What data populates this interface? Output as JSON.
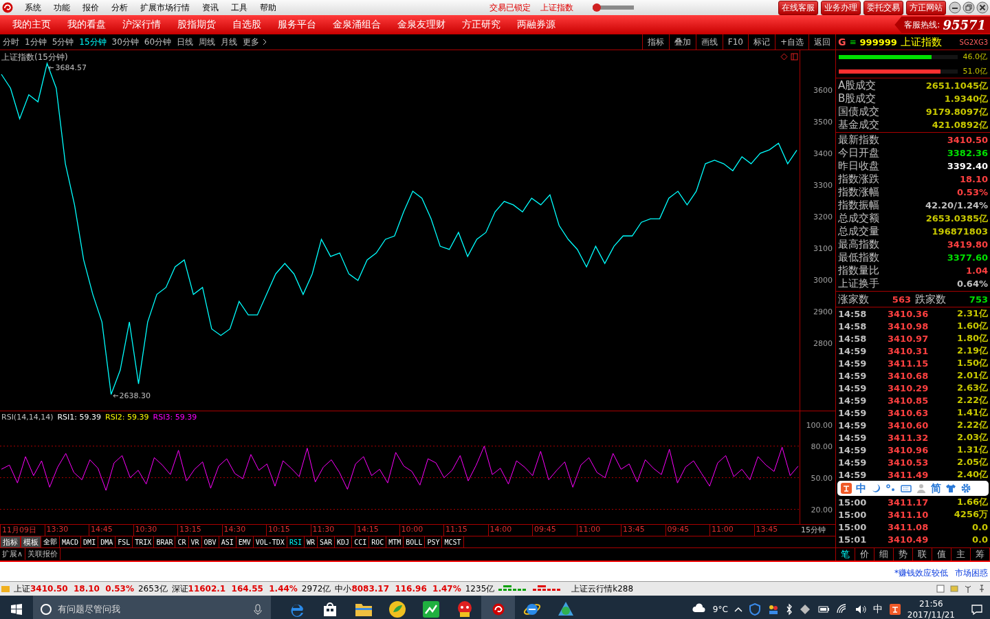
{
  "title_bar": {
    "menus": [
      "系统",
      "功能",
      "报价",
      "分析",
      "扩展市场行情",
      "资讯",
      "工具",
      "帮助"
    ],
    "lock_status": "交易已锁定",
    "security": "上证指数",
    "slider": {
      "level": 0.1
    },
    "buttons": [
      "在线客服",
      "业务办理",
      "委托交易",
      "方正网站"
    ]
  },
  "nav": {
    "items": [
      "我的主页",
      "我的看盘",
      "沪深行情",
      "股指期货",
      "自选股",
      "服务平台",
      "金泉涌组合",
      "金泉友理财",
      "方正研究",
      "两融券源"
    ],
    "hotline_label": "客服热线:",
    "hotline": "95571"
  },
  "periods": [
    {
      "label": "分时",
      "selected": false
    },
    {
      "label": "1分钟",
      "selected": false
    },
    {
      "label": "5分钟",
      "selected": false
    },
    {
      "label": "15分钟",
      "selected": true
    },
    {
      "label": "30分钟",
      "selected": false
    },
    {
      "label": "60分钟",
      "selected": false
    },
    {
      "label": "日线",
      "selected": false
    },
    {
      "label": "周线",
      "selected": false
    },
    {
      "label": "月线",
      "selected": false
    },
    {
      "label": "更多",
      "selected": false
    }
  ],
  "chart_tools": [
    "指标",
    "叠加",
    "画线",
    "F10",
    "标记",
    "+自选",
    "返回"
  ],
  "main_chart": {
    "chart_data": {
      "type": "line",
      "title": "上证指数(15分钟)",
      "ylim": [
        2591,
        3726
      ],
      "yticks": [
        2800,
        2900,
        3000,
        3100,
        3200,
        3300,
        3400,
        3500,
        3600
      ],
      "series": [
        {
          "color": "#00ffff",
          "values": [
            3650,
            3606,
            3509,
            3585,
            3563,
            3684,
            3606,
            3367,
            3237,
            3063,
            2954,
            2867,
            2638,
            2715,
            2867,
            2671,
            2867,
            2954,
            2976,
            3041,
            3063,
            2954,
            2976,
            2845,
            2824,
            2845,
            2932,
            2889,
            2889,
            2954,
            3019,
            3052,
            3019,
            2954,
            3019,
            3128,
            3074,
            3085,
            3019,
            2998,
            3063,
            3085,
            3128,
            3139,
            3215,
            3280,
            3258,
            3193,
            3106,
            3096,
            3150,
            3074,
            3128,
            3150,
            3215,
            3248,
            3237,
            3215,
            3258,
            3237,
            3269,
            3172,
            3128,
            3096,
            3041,
            3106,
            3052,
            3106,
            3139,
            3139,
            3182,
            3193,
            3193,
            3258,
            3280,
            3237,
            3280,
            3367,
            3378,
            3367,
            3345,
            3389,
            3367,
            3400,
            3411,
            3432,
            3367,
            3410
          ]
        }
      ],
      "annotations": [
        {
          "text": "3684.57"
        },
        {
          "text": "2638.30"
        }
      ]
    }
  },
  "rsi": {
    "chart_data": {
      "type": "line",
      "grid": true,
      "ylim": [
        6,
        113
      ],
      "yticks": [
        {
          "value": 100,
          "label": "100.00"
        },
        {
          "value": 80,
          "label": "80.00"
        },
        {
          "value": 50,
          "label": "50.00"
        },
        {
          "value": 20,
          "label": "20.00"
        }
      ],
      "series": [
        {
          "color": "#ff00ff",
          "values": [
            58,
            62,
            45,
            70,
            52,
            66,
            41,
            60,
            73,
            55,
            48,
            67,
            59,
            38,
            64,
            71,
            50,
            57,
            44,
            69,
            62,
            53,
            76,
            47,
            58,
            65,
            40,
            61,
            68,
            54,
            49,
            72,
            57,
            63,
            42,
            66,
            59,
            51,
            78,
            46,
            60,
            67,
            55,
            39,
            63,
            70,
            52,
            58,
            45,
            74,
            61,
            56,
            43,
            68,
            64,
            50,
            57,
            71,
            47,
            62,
            80,
            53,
            59,
            44,
            66,
            60,
            52,
            75,
            48,
            57,
            65,
            41,
            62,
            69,
            55,
            50,
            73,
            58,
            63,
            46,
            67,
            59,
            53,
            77,
            45,
            60,
            66,
            54,
            42,
            64,
            71,
            51,
            58,
            48,
            70,
            62,
            56,
            79,
            52,
            61
          ]
        }
      ]
    },
    "legend": [
      {
        "text": "RSI(14,14,14)",
        "color": "#c0c0c0"
      },
      {
        "text": "RSI1: 59.39",
        "color": "#ffffff"
      },
      {
        "text": "RSI2: 59.39",
        "color": "#ffff00"
      },
      {
        "text": "RSI3: 59.39",
        "color": "#ff00ff"
      }
    ]
  },
  "time_axis": {
    "labels": [
      "11月09日",
      "13:30",
      "14:45",
      "10:30",
      "13:15",
      "14:30",
      "10:15",
      "11:30",
      "14:15",
      "10:00",
      "11:15",
      "14:00",
      "09:45",
      "11:00",
      "13:45",
      "09:45",
      "11:00",
      "13:45"
    ],
    "period": "15分钟"
  },
  "indicator_tabs": [
    {
      "label": "指标",
      "kind": "tool",
      "selected": false
    },
    {
      "label": "模板",
      "kind": "tool",
      "selected": false
    },
    {
      "label": "全部",
      "kind": "index",
      "selected": false
    },
    {
      "label": "MACD",
      "kind": "index",
      "selected": false
    },
    {
      "label": "DMI",
      "kind": "index",
      "selected": false
    },
    {
      "label": "DMA",
      "kind": "index",
      "selected": false
    },
    {
      "label": "FSL",
      "kind": "index",
      "selected": false
    },
    {
      "label": "TRIX",
      "kind": "index",
      "selected": false
    },
    {
      "label": "BRAR",
      "kind": "index",
      "selected": false
    },
    {
      "label": "CR",
      "kind": "index",
      "selected": false
    },
    {
      "label": "VR",
      "kind": "index",
      "selected": false
    },
    {
      "label": "OBV",
      "kind": "index",
      "selected": false
    },
    {
      "label": "ASI",
      "kind": "index",
      "selected": false
    },
    {
      "label": "EMV",
      "kind": "index",
      "selected": false
    },
    {
      "label": "VOL-TDX",
      "kind": "index",
      "selected": false
    },
    {
      "label": "RSI",
      "kind": "index",
      "selected": true
    },
    {
      "label": "WR",
      "kind": "index",
      "selected": false
    },
    {
      "label": "SAR",
      "kind": "index",
      "selected": false
    },
    {
      "label": "KDJ",
      "kind": "index",
      "selected": false
    },
    {
      "label": "CCI",
      "kind": "index",
      "selected": false
    },
    {
      "label": "ROC",
      "kind": "index",
      "selected": false
    },
    {
      "label": "MTM",
      "kind": "index",
      "selected": false
    },
    {
      "label": "BOLL",
      "kind": "index",
      "selected": false
    },
    {
      "label": "PSY",
      "kind": "index",
      "selected": false
    },
    {
      "label": "MCST",
      "kind": "index",
      "selected": false
    }
  ],
  "extra_tabs": [
    "扩展∧",
    "关联报价"
  ],
  "quote_panel": {
    "badge": "G",
    "menu_glyph": "≡",
    "code": "999999",
    "name": "上证指数",
    "signals": "SG2XG3",
    "volume_bars": [
      {
        "level": 0.78,
        "reading": "46.0亿",
        "color": "#00e000"
      },
      {
        "level": 0.86,
        "reading": "51.0亿",
        "color": "#ff3030"
      }
    ],
    "turnover": [
      {
        "label": "A股成交",
        "value": "2651.1045亿"
      },
      {
        "label": "B股成交",
        "value": "1.9340亿"
      },
      {
        "label": "国债成交",
        "value": "9179.8097亿"
      },
      {
        "label": "基金成交",
        "value": "421.0892亿"
      }
    ],
    "stats": [
      {
        "label": "最新指数",
        "value": "3410.50",
        "color": "#ff4040"
      },
      {
        "label": "今日开盘",
        "value": "3382.36",
        "color": "#00e000"
      },
      {
        "label": "昨日收盘",
        "value": "3392.40",
        "color": "#ffffff"
      },
      {
        "label": "指数涨跌",
        "value": "18.10",
        "color": "#ff4040"
      },
      {
        "label": "指数涨幅",
        "value": "0.53%",
        "color": "#ff4040"
      },
      {
        "label": "指数振幅",
        "value": "42.20/1.24%",
        "color": "#c0c0c0"
      },
      {
        "label": "总成交额",
        "value": "2653.0385亿",
        "color": "#c8c800"
      },
      {
        "label": "总成交量",
        "value": "196871803",
        "color": "#c8c800"
      },
      {
        "label": "最高指数",
        "value": "3419.80",
        "color": "#ff4040"
      },
      {
        "label": "最低指数",
        "value": "3377.60",
        "color": "#00e000"
      },
      {
        "label": "指数量比",
        "value": "1.04",
        "color": "#ff4040"
      },
      {
        "label": "上证换手",
        "value": "0.64%",
        "color": "#c0c0c0"
      }
    ],
    "breadth": {
      "up_label": "涨家数",
      "up": "563",
      "down_label": "跌家数",
      "down": "753"
    },
    "ticks": [
      {
        "time": "14:58",
        "price": "3410.36",
        "volume": "2.31亿"
      },
      {
        "time": "14:58",
        "price": "3410.98",
        "volume": "1.60亿"
      },
      {
        "time": "14:58",
        "price": "3410.97",
        "volume": "1.80亿"
      },
      {
        "time": "14:59",
        "price": "3410.31",
        "volume": "2.19亿"
      },
      {
        "time": "14:59",
        "price": "3411.15",
        "volume": "1.50亿"
      },
      {
        "time": "14:59",
        "price": "3410.68",
        "volume": "2.01亿"
      },
      {
        "time": "14:59",
        "price": "3410.29",
        "volume": "2.63亿"
      },
      {
        "time": "14:59",
        "price": "3410.85",
        "volume": "2.22亿"
      },
      {
        "time": "14:59",
        "price": "3410.63",
        "volume": "1.41亿"
      },
      {
        "time": "14:59",
        "price": "3410.60",
        "volume": "2.22亿"
      },
      {
        "time": "14:59",
        "price": "3411.32",
        "volume": "2.03亿"
      },
      {
        "time": "14:59",
        "price": "3410.96",
        "volume": "1.31亿"
      },
      {
        "time": "14:59",
        "price": "3410.53",
        "volume": "2.05亿"
      },
      {
        "time": "14:59",
        "price": "3411.49",
        "volume": "2.40亿"
      }
    ],
    "ime_bar": {
      "mode": "中",
      "script": "简"
    },
    "ticks_below": [
      {
        "time": "15:00",
        "price": "3411.17",
        "volume": "1.66亿"
      },
      {
        "time": "15:00",
        "price": "3411.10",
        "volume": "4256万"
      },
      {
        "time": "15:00",
        "price": "3411.08",
        "volume": "0.0"
      },
      {
        "time": "15:01",
        "price": "3410.49",
        "volume": "0.0"
      }
    ],
    "tabs": [
      {
        "label": "笔",
        "selected": true
      },
      {
        "label": "价",
        "selected": false
      },
      {
        "label": "细",
        "selected": false
      },
      {
        "label": "势",
        "selected": false
      },
      {
        "label": "联",
        "selected": false
      },
      {
        "label": "值",
        "selected": false
      },
      {
        "label": "主",
        "selected": false
      },
      {
        "label": "筹",
        "selected": false
      }
    ]
  },
  "alerts": [
    "*赚钱效应较低",
    "市场困惑"
  ],
  "status_bar": {
    "markets": [
      {
        "name": "上证",
        "price": "3410.50",
        "change": "18.10",
        "pct": "0.53%",
        "amount": "2653亿"
      },
      {
        "name": "深证",
        "price": "11602.1",
        "change": "164.55",
        "pct": "1.44%",
        "amount": "2972亿"
      },
      {
        "name": "中小",
        "price": "8083.17",
        "change": "116.96",
        "pct": "1.47%",
        "amount": "1235亿"
      }
    ],
    "cloud": "上证云行情k288"
  },
  "taskbar": {
    "search_placeholder": "有问题尽管问我",
    "weather": "9°C",
    "ime": "中",
    "time": "21:56",
    "date": "2017/11/21"
  }
}
